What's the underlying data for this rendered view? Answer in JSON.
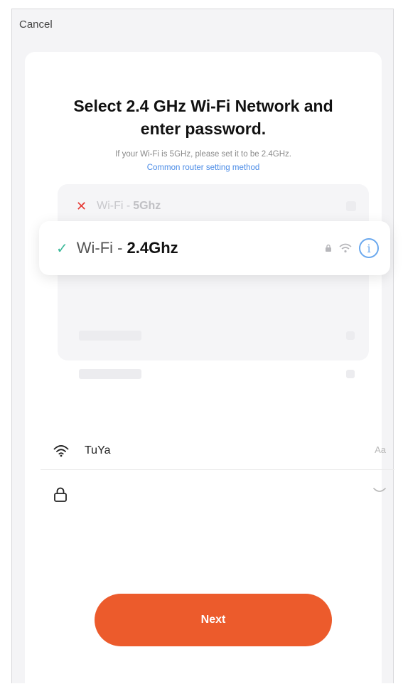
{
  "header": {
    "cancel_label": "Cancel"
  },
  "main": {
    "title_line1": "Select 2.4 GHz Wi-Fi Network and",
    "title_line2": "enter password.",
    "hint": "If your Wi-Fi is 5GHz, please set it to be 2.4GHz.",
    "router_link": "Common router setting method"
  },
  "networks": {
    "unsupported": {
      "name": "Wi-Fi - ",
      "band": "5Ghz"
    },
    "supported": {
      "name": "Wi-Fi - ",
      "band": "2.4Ghz"
    }
  },
  "form": {
    "ssid_value": "TuYa",
    "text_mode_toggle": "Aa",
    "password_value": ""
  },
  "footer": {
    "next_label": "Next"
  },
  "colors": {
    "accent": "#ec5b2c",
    "link": "#4a8be6",
    "check": "#3cb99a",
    "error": "#e63b36"
  }
}
